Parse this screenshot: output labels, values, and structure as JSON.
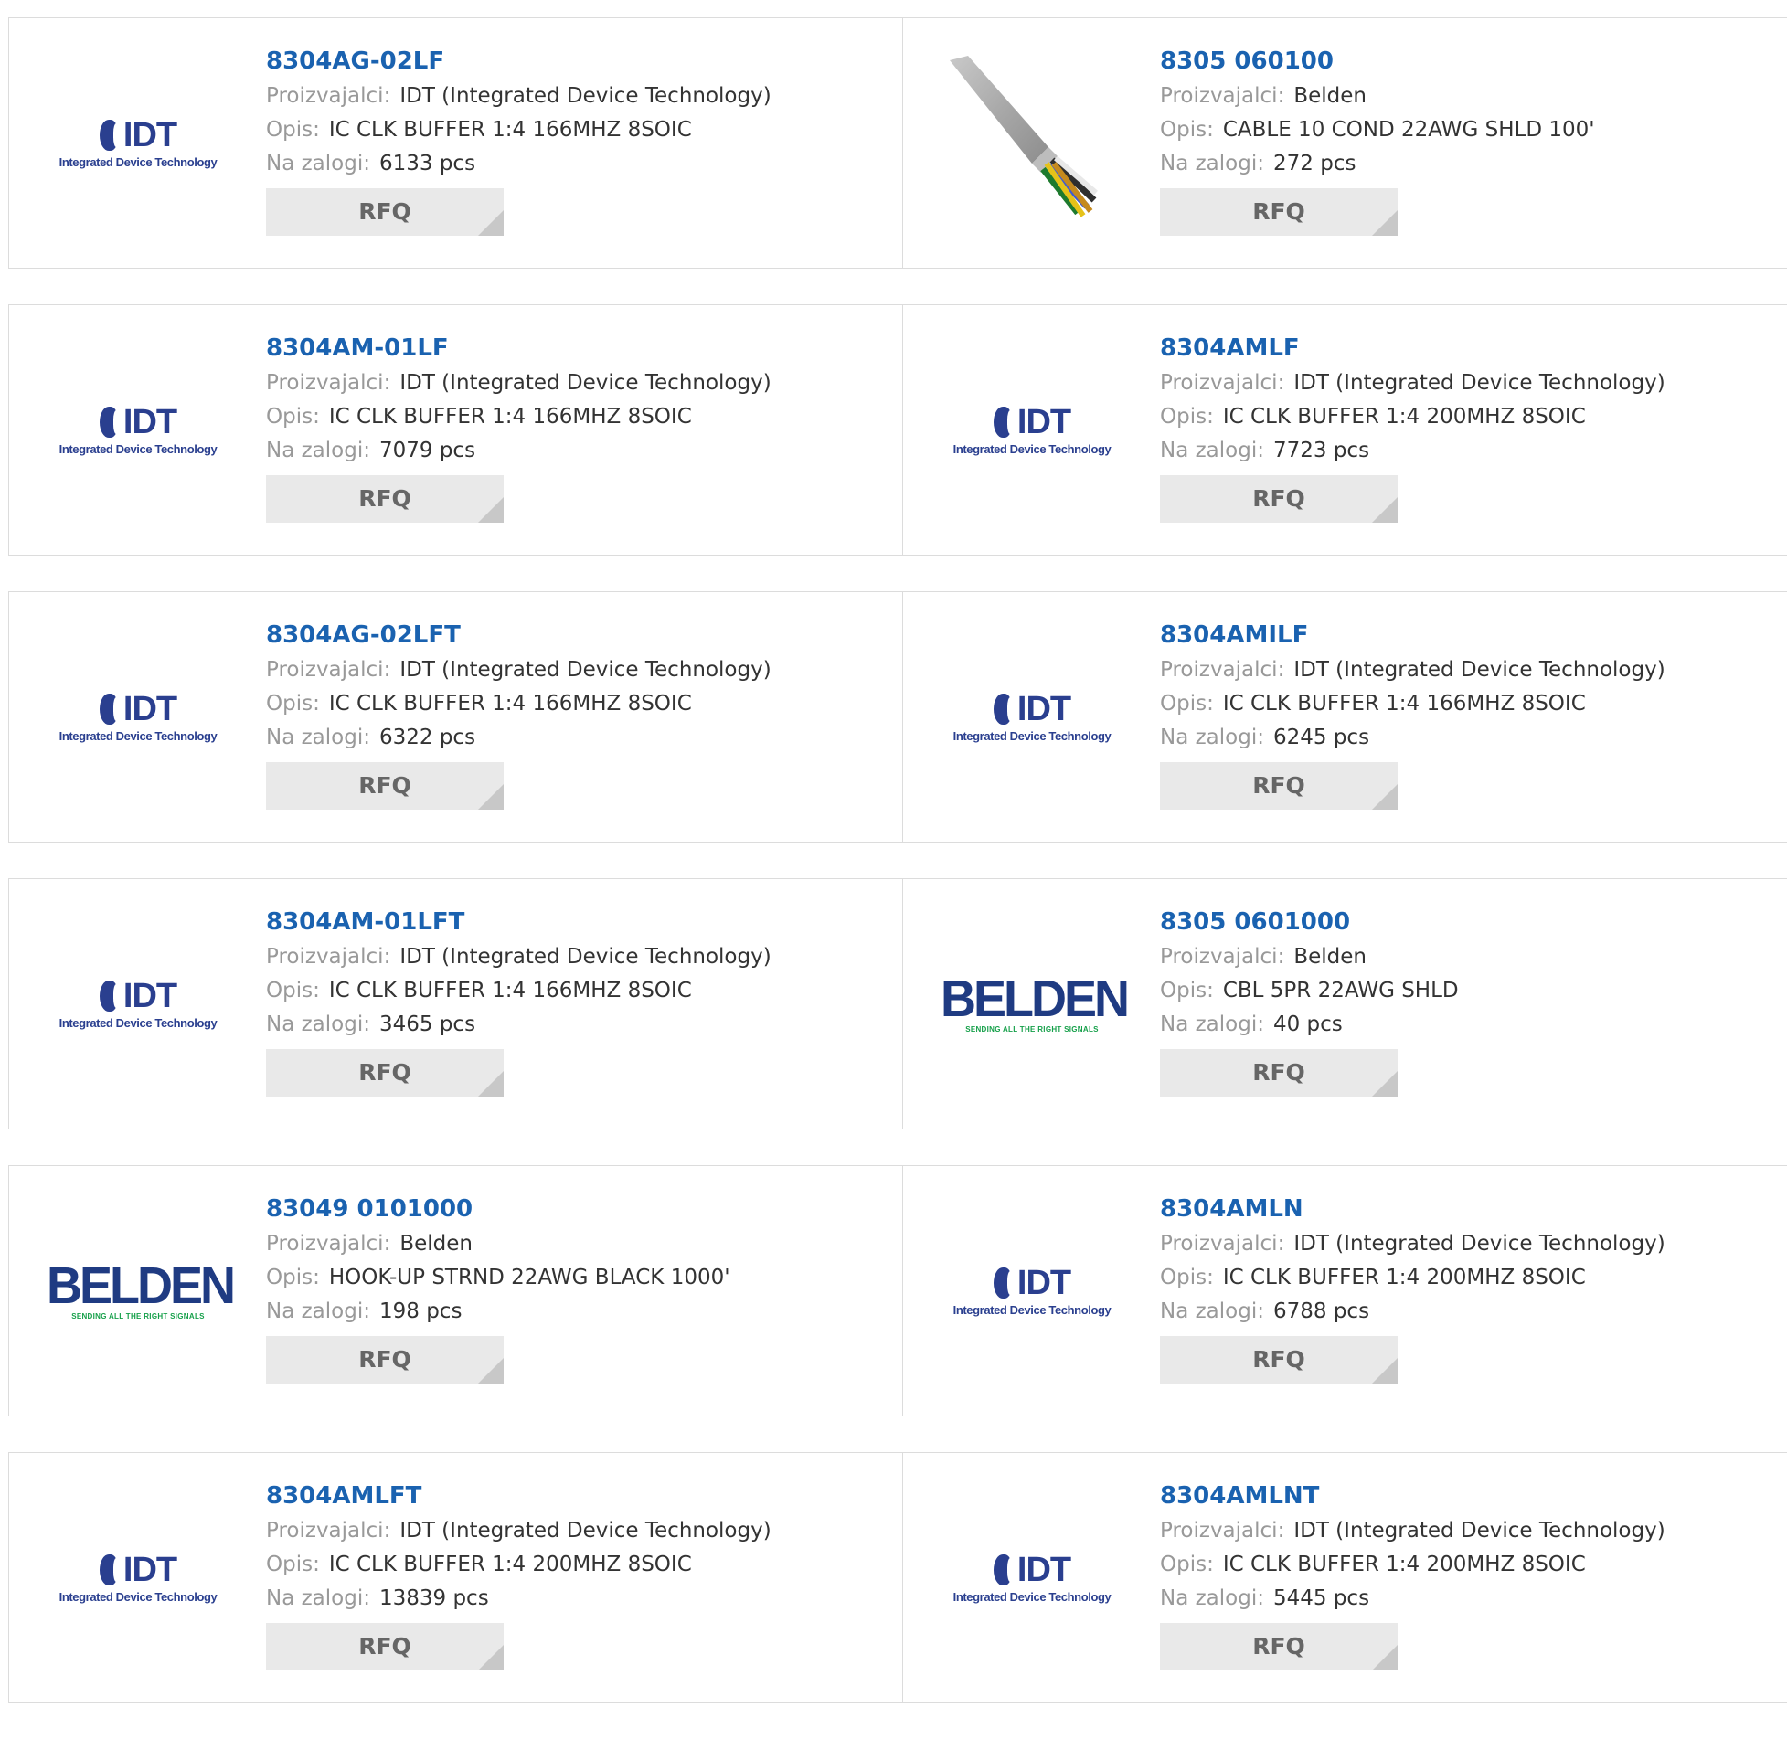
{
  "labels": {
    "manufacturer": "Proizvajalci:",
    "description": "Opis:",
    "stock": "Na zalogi:",
    "rfq": "RFQ"
  },
  "logos": {
    "idt_title": "IDT",
    "idt_subtitle": "Integrated Device Technology",
    "belden_title": "BELDEN",
    "belden_subtitle": "SENDING ALL THE RIGHT SIGNALS"
  },
  "colors": {
    "link": "#1a62b0",
    "label": "#999999",
    "button_bg": "#e9e9e9"
  },
  "products": [
    {
      "part": "8304AG-02LF",
      "manufacturer": "IDT (Integrated Device Technology)",
      "description": "IC CLK BUFFER 1:4 166MHZ 8SOIC",
      "stock": "6133 pcs",
      "image": "idt-logo"
    },
    {
      "part": "8305 060100",
      "manufacturer": "Belden",
      "description": "CABLE 10 COND 22AWG SHLD 100'",
      "stock": "272 pcs",
      "image": "cable-photo"
    },
    {
      "part": "8304AM-01LF",
      "manufacturer": "IDT (Integrated Device Technology)",
      "description": "IC CLK BUFFER 1:4 166MHZ 8SOIC",
      "stock": "7079 pcs",
      "image": "idt-logo"
    },
    {
      "part": "8304AMLF",
      "manufacturer": "IDT (Integrated Device Technology)",
      "description": "IC CLK BUFFER 1:4 200MHZ 8SOIC",
      "stock": "7723 pcs",
      "image": "idt-logo"
    },
    {
      "part": "8304AG-02LFT",
      "manufacturer": "IDT (Integrated Device Technology)",
      "description": "IC CLK BUFFER 1:4 166MHZ 8SOIC",
      "stock": "6322 pcs",
      "image": "idt-logo"
    },
    {
      "part": "8304AMILF",
      "manufacturer": "IDT (Integrated Device Technology)",
      "description": "IC CLK BUFFER 1:4 166MHZ 8SOIC",
      "stock": "6245 pcs",
      "image": "idt-logo"
    },
    {
      "part": "8304AM-01LFT",
      "manufacturer": "IDT (Integrated Device Technology)",
      "description": "IC CLK BUFFER 1:4 166MHZ 8SOIC",
      "stock": "3465 pcs",
      "image": "idt-logo"
    },
    {
      "part": "8305 0601000",
      "manufacturer": "Belden",
      "description": "CBL 5PR 22AWG SHLD",
      "stock": "40 pcs",
      "image": "belden-logo"
    },
    {
      "part": "83049 0101000",
      "manufacturer": "Belden",
      "description": "HOOK-UP STRND 22AWG BLACK 1000'",
      "stock": "198 pcs",
      "image": "belden-logo"
    },
    {
      "part": "8304AMLN",
      "manufacturer": "IDT (Integrated Device Technology)",
      "description": "IC CLK BUFFER 1:4 200MHZ 8SOIC",
      "stock": "6788 pcs",
      "image": "idt-logo"
    },
    {
      "part": "8304AMLFT",
      "manufacturer": "IDT (Integrated Device Technology)",
      "description": "IC CLK BUFFER 1:4 200MHZ 8SOIC",
      "stock": "13839 pcs",
      "image": "idt-logo"
    },
    {
      "part": "8304AMLNT",
      "manufacturer": "IDT (Integrated Device Technology)",
      "description": "IC CLK BUFFER 1:4 200MHZ 8SOIC",
      "stock": "5445 pcs",
      "image": "idt-logo"
    }
  ]
}
